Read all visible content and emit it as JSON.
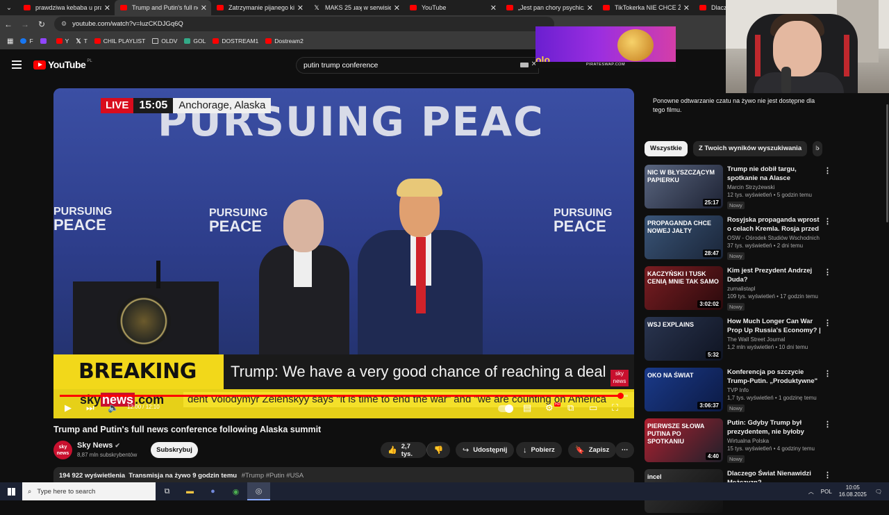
{
  "browser": {
    "tabs": [
      {
        "label": "prawdziwa kebaba u prav",
        "icon": "youtube-icon"
      },
      {
        "label": "Trump and Putin's full ne",
        "icon": "youtube-icon",
        "active": true
      },
      {
        "label": "Zatrzymanie pijanego kie",
        "icon": "youtube-icon"
      },
      {
        "label": "MAKS 25 ɹaʞ w serwisie",
        "icon": "x-icon"
      },
      {
        "label": "YouTube",
        "icon": "youtube-icon"
      },
      {
        "label": "„Jest pan chory psychiczn",
        "icon": "youtube-icon"
      },
      {
        "label": "TikTokerka NIE CHCE Żeb",
        "icon": "youtube-icon"
      },
      {
        "label": "Dlaczeg",
        "icon": "youtube-icon"
      }
    ],
    "url": "youtube.com/watch?v=luzCKDJGq6Q",
    "bookmarks": [
      {
        "label": "F",
        "icon": "facebook"
      },
      {
        "label": "",
        "icon": "twitch"
      },
      {
        "label": "Y",
        "icon": "youtube"
      },
      {
        "label": "T",
        "icon": "x"
      },
      {
        "label": "CHIL PLAYLIST",
        "icon": "youtube"
      },
      {
        "label": "OLDV",
        "icon": "folder"
      },
      {
        "label": "GOL",
        "icon": "gol"
      },
      {
        "label": "DOSTREAM1",
        "icon": "youtube"
      },
      {
        "label": "Dostream2",
        "icon": "youtube"
      }
    ]
  },
  "youtube": {
    "logo_text": "YouTube",
    "country": "PL",
    "search_value": "putin trump conference"
  },
  "ad": {
    "brand_text": "PIRATESWAP.COM",
    "partial_text": "olo"
  },
  "video": {
    "backdrop_text": "PURSUING PEAC",
    "backdrop_small_1": "PURSUING",
    "backdrop_small_2": "PEACE",
    "live_label": "LIVE",
    "live_time": "15:05",
    "live_location": "Anchorage, Alaska",
    "breaking_label": "BREAKING NEWS",
    "headline": "Trump: We have a very good chance of reaching a deal",
    "channel_bug_1": "sky",
    "channel_bug_2": "news",
    "ticker_site_1": "sky",
    "ticker_site_2": "news",
    "ticker_site_3": ".com",
    "ticker_text": "dent Volodymyr Zelenskyy says \"it is time to end the war\" and \"we are counting on America",
    "timecode": "12:00 / 12:10",
    "progress_fraction": 0.99
  },
  "meta": {
    "title": "Trump and Putin's full news conference following Alaska summit",
    "channel": "Sky News",
    "avatar_text_1": "sky",
    "avatar_text_2": "news",
    "subscribers": "8,87 mln subskrybentów",
    "subscribe_label": "Subskrybuj",
    "likes": "2,7 tys.",
    "share_label": "Udostępnij",
    "download_label": "Pobierz",
    "save_label": "Zapisz",
    "views": "194 922 wyświetlenia",
    "streamed": "Transmisja na żywo 9 godzin temu",
    "tags": "#Trump #Putin #USA"
  },
  "sidebar": {
    "chat_note": "Ponowne odtwarzanie czatu na żywo nie jest dostępne dla tego filmu.",
    "chips": [
      "Wszystkie",
      "Z Twoich wyników wyszukiwania",
      "I"
    ],
    "recommendations": [
      {
        "title": "Trump nie dobił targu, spotkanie na Alasce zakończy...",
        "channel": "Marcin Strzyżewski",
        "meta": "12 tys. wyświetleń • 5 godzin temu",
        "badge": "Nowy",
        "duration": "25:17",
        "thumb_text": "NIC W BŁYSZCZĄCYM PAPIERKU"
      },
      {
        "title": "Rosyjska propaganda wprost o celach Kremla. Rosja przed ...",
        "channel": "OSW - Ośrodek Studiów Wschodnich",
        "meta": "37 tys. wyświetleń • 2 dni temu",
        "badge": "Nowy",
        "duration": "28:47",
        "thumb_text": "PROPAGANDA CHCE NOWEJ JAŁTY"
      },
      {
        "title": "Kim jest Prezydent Andrzej Duda?",
        "channel": "zurnalistapl",
        "meta": "109 tys. wyświetleń • 17 godzin temu",
        "badge": "Nowy",
        "duration": "3:02:02",
        "thumb_text": "KACZYŃSKI I TUSK CENIĄ MNIE TAK SAMO"
      },
      {
        "title": "How Much Longer Can War Prop Up Russia's Economy? | ...",
        "channel": "The Wall Street Journal",
        "meta": "1,2 mln wyświetleń • 10 dni temu",
        "badge": "",
        "duration": "5:32",
        "thumb_text": "WSJ EXPLAINS"
      },
      {
        "title": "Konferencja po szczycie Trump-Putin. „Produktywne\" rozmow...",
        "channel": "TVP Info",
        "meta": "1,7 tys. wyświetleń • 1 godzinę temu",
        "badge": "Nowy",
        "duration": "3:06:37",
        "thumb_text": "OKO NA ŚWIAT"
      },
      {
        "title": "Putin: Gdyby Trump był prezydentem, nie byłoby wojny",
        "channel": "Wirtualna Polska",
        "meta": "15 tys. wyświetleń • 4 godziny temu",
        "badge": "Nowy",
        "duration": "4:40",
        "thumb_text": "PIERWSZE SŁOWA PUTINA PO SPOTKANIU"
      },
      {
        "title": "Dlaczego Świat Nienawidzi Mężczyzn?",
        "channel": "",
        "meta": "",
        "badge": "",
        "duration": "",
        "thumb_text": "incel"
      }
    ]
  },
  "taskbar": {
    "search_placeholder": "Type here to search",
    "language": "POL",
    "time": "10:05",
    "date": "16.08.2025"
  }
}
